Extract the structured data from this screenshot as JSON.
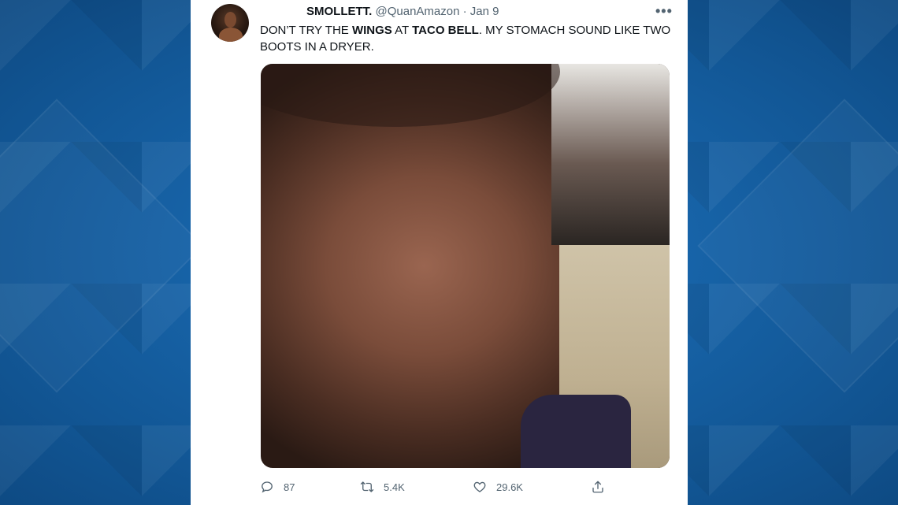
{
  "tweet": {
    "display_name": "SMOLLETT.",
    "handle": "@QuanAmazon",
    "separator": "·",
    "date": "Jan 9",
    "text_parts": [
      "DON’T TRY THE ",
      "WINGS",
      " AT ",
      "TACO BELL",
      ". MY STOMACH SOUND LIKE TWO BOOTS IN A DRYER."
    ],
    "more_label": "•••"
  },
  "actions": {
    "replies": "87",
    "retweets": "5.4K",
    "likes": "29.6K"
  },
  "icons": {
    "reply": "reply-icon",
    "retweet": "retweet-icon",
    "like": "heart-icon",
    "share": "share-icon",
    "more": "more-options-icon"
  },
  "colors": {
    "background": "#1563a8",
    "card": "#ffffff",
    "text_primary": "#0f1419",
    "text_secondary": "#536471"
  }
}
